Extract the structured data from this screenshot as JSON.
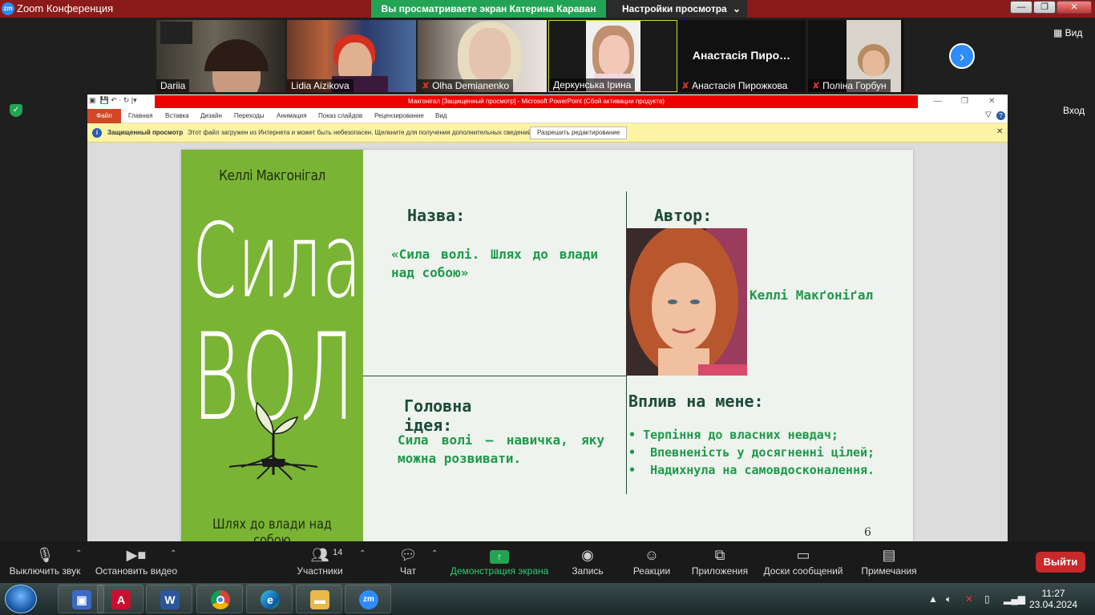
{
  "app": {
    "title": "Zoom Конференция",
    "logo": "zm",
    "share_banner": "Вы просматриваете экран Катерина Караван",
    "view_settings": "Настройки просмотра",
    "view_button": "Вид",
    "exit_fullscreen": "Вход"
  },
  "participants_strip": [
    {
      "name": "Dariia",
      "muted": false
    },
    {
      "name": "Lidia Aizikova",
      "muted": false
    },
    {
      "name": "Olha Demianenko",
      "muted": true
    },
    {
      "name": "Деркунська Ірина",
      "muted": false,
      "active": true
    },
    {
      "name": "Анастасія Пирожкова",
      "muted": true,
      "big_name": "Анастасія  Пиро…"
    },
    {
      "name": "Поліна Горбун",
      "muted": true
    }
  ],
  "ppt": {
    "title": "Макгонігал [Защищенный просмотр] - Microsoft PowerPoint (Сбой активации продукта)",
    "tabs": [
      "Файл",
      "Главная",
      "Вставка",
      "Дизайн",
      "Переходы",
      "Анимация",
      "Показ слайдов",
      "Рецензирование",
      "Вид"
    ],
    "protected_label": "Защищенный просмотр",
    "protected_message": "Этот файл загружен из Интернета и может быть небезопасен. Щелкните для получения дополнительных сведений.",
    "enable_editing": "Разрешить редактирование"
  },
  "slide": {
    "book": {
      "author": "Келлі Макгонігал",
      "title_line1": "Сила",
      "title_line2": "ВОЛІ",
      "subtitle": "Шлях до влади над собою"
    },
    "name_heading": "Назва:",
    "name_text": "«Сила волі. Шлях до влади над собою»",
    "author_heading": "Автор:",
    "author_name": "Келлі Макґоніґал",
    "idea_heading_1": "Головна",
    "idea_heading_2": "ідея:",
    "idea_text": "Сила волі — навичка, яку можна розвивати.",
    "impact_heading": "Вплив на мене:",
    "impact_items": [
      "Терпіння до власних невдач;",
      "Впевненість у досягненні цілей;",
      "Надихнула на самовдосконалення."
    ],
    "slide_number": "6"
  },
  "toolbar": {
    "mute": "Выключить звук",
    "video": "Остановить видео",
    "participants": "Участники",
    "participants_count": "14",
    "chat": "Чат",
    "share": "Демонстрация экрана",
    "record": "Запись",
    "reactions": "Реакции",
    "apps": "Приложения",
    "whiteboards": "Доски сообщений",
    "notes": "Примечания",
    "leave": "Выйти"
  },
  "taskbar": {
    "apps": [
      "remote-desktop",
      "acrobat",
      "word",
      "chrome",
      "edge",
      "explorer",
      "zoom"
    ],
    "time": "11:27",
    "date": "23.04.2024"
  },
  "colors": {
    "share_green": "#23a455",
    "zoom_blue": "#2d8cff",
    "book_green": "#7ab434",
    "leave_red": "#c8292a"
  }
}
